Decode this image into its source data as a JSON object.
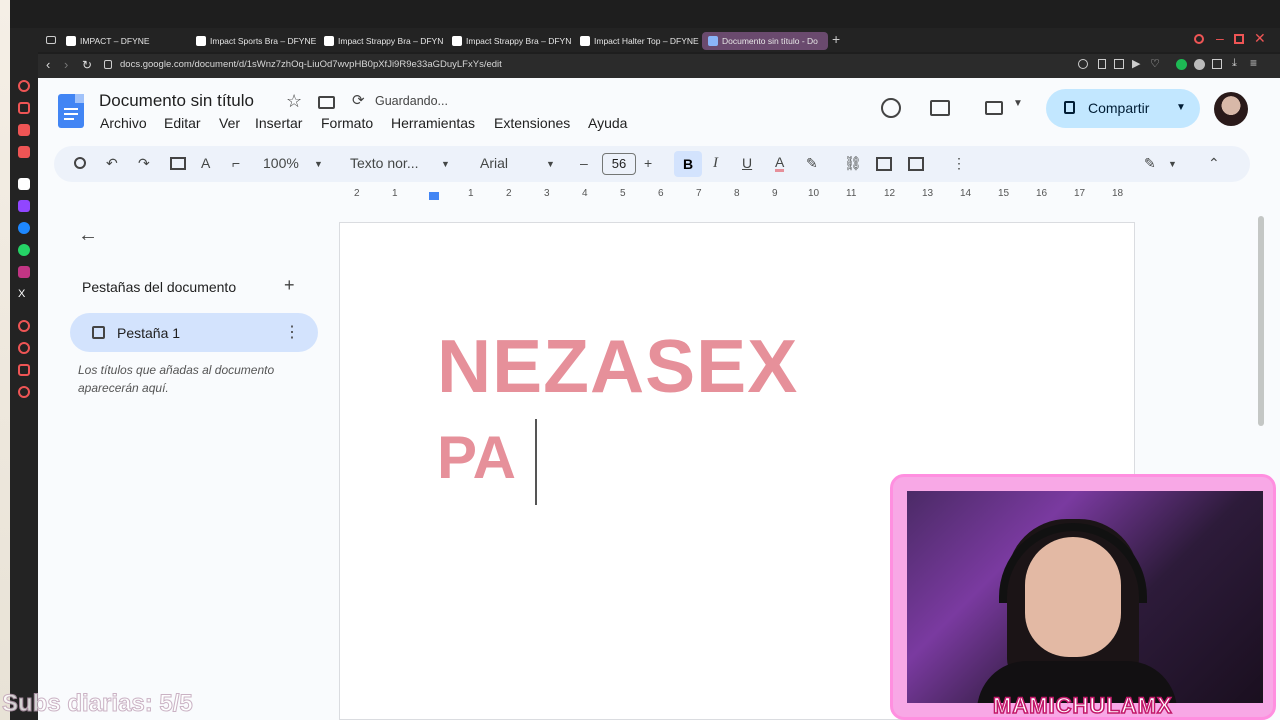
{
  "browser": {
    "tabs": [
      {
        "label": "IMPACT – DFYNE"
      },
      {
        "label": "Impact Sports Bra – DFYNE"
      },
      {
        "label": "Impact Strappy Bra – DFYNE"
      },
      {
        "label": "Impact Strappy Bra – DFYNE"
      },
      {
        "label": "Impact Halter Top – DFYNE"
      },
      {
        "label": "Documento sin título - Do"
      }
    ],
    "url": "docs.google.com/document/d/1sWnz7zhOq-LiuOd7wvpHB0pXfJi9R9e33aGDuyLFxYs/edit"
  },
  "docs": {
    "title": "Documento sin título",
    "save_status": "Guardando...",
    "menus": [
      "Archivo",
      "Editar",
      "Ver",
      "Insertar",
      "Formato",
      "Herramientas",
      "Extensiones",
      "Ayuda"
    ],
    "share_label": "Compartir",
    "toolbar": {
      "zoom": "100%",
      "style": "Texto nor...",
      "font": "Arial",
      "font_size": "56",
      "bold": "B",
      "italic": "I",
      "underline": "U",
      "text_color": "A"
    },
    "ruler": [
      "2",
      "1",
      "1",
      "2",
      "3",
      "4",
      "5",
      "6",
      "7",
      "8",
      "9",
      "10",
      "11",
      "12",
      "13",
      "14",
      "15",
      "16",
      "17",
      "18"
    ],
    "outline": {
      "title": "Pestañas del documento",
      "tab_label": "Pestaña 1",
      "hint": "Los títulos que añadas al documento aparecerán aquí."
    },
    "body": {
      "line1": "NEZASEX",
      "line2": "PA"
    },
    "accent_color": "#c2e7ff",
    "text_color": "#e6909a"
  },
  "overlay": {
    "subs": "Subs diarias: 5/5",
    "cam_name": "MAMICHULAMX"
  }
}
